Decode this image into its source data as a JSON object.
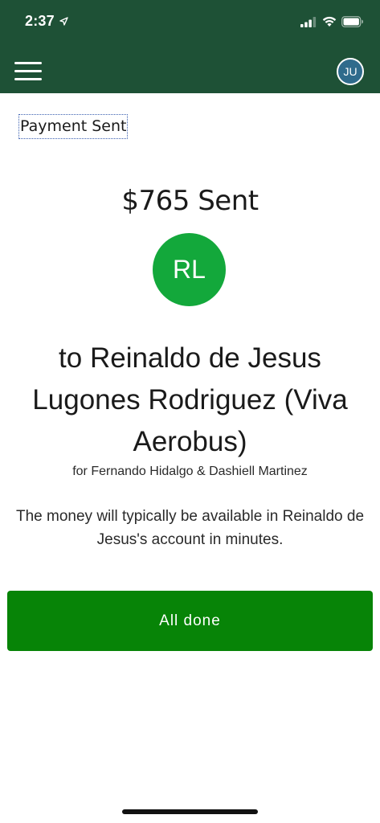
{
  "status_bar": {
    "time": "2:37",
    "icons": [
      "location-arrow-icon",
      "cellular-signal-icon",
      "wifi-icon",
      "battery-icon"
    ]
  },
  "nav": {
    "menu_icon": "hamburger-menu-icon",
    "user_initials": "JU"
  },
  "page": {
    "title": "Payment Sent"
  },
  "payment": {
    "amount_line": "$765 Sent",
    "recipient_initials": "RL",
    "recipient_line": "to Reinaldo de Jesus Lugones Rodriguez (Viva Aerobus)",
    "for_line": "for Fernando Hidalgo & Dashiell Martinez",
    "info_text": "The money will typically be available in Reinaldo de Jesus's account in minutes."
  },
  "actions": {
    "done_label": "All done"
  },
  "colors": {
    "header_bg": "#1e5136",
    "avatar_green": "#13a83b",
    "button_green": "#078407",
    "user_avatar_bg": "#2f6b8c"
  }
}
